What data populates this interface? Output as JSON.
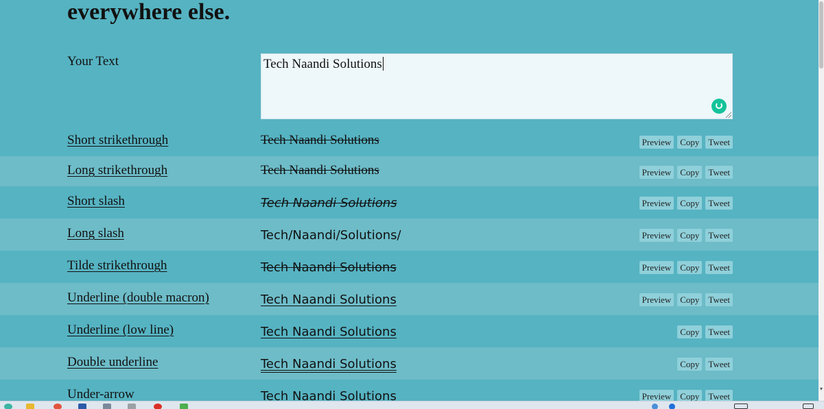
{
  "page": {
    "heading": "everywhere else."
  },
  "input": {
    "label": "Your Text",
    "value": "Tech Naandi Solutions"
  },
  "buttons": {
    "preview": "Preview",
    "copy": "Copy",
    "tweet": "Tweet"
  },
  "rows": [
    {
      "label": "Short strikethrough",
      "result": "Tech Naandi Solutions"
    },
    {
      "label": "Long strikethrough",
      "result": "Tech Naandi Solutions"
    },
    {
      "label": "Short slash",
      "result": "Tech Naandi Solutions"
    },
    {
      "label": "Long slash",
      "result": "Tech/Naandi/Solutions/"
    },
    {
      "label": "Tilde strikethrough",
      "result": "Tech Naandi Solutions"
    },
    {
      "label": "Underline (double macron)",
      "result": "Tech Naandi Solutions"
    },
    {
      "label": "Underline (low line)",
      "result": "Tech Naandi Solutions"
    },
    {
      "label": "Double underline",
      "result": "Tech Naandi Solutions"
    },
    {
      "label": "Under-arrow",
      "result": "Tech Naandi Solutions"
    }
  ],
  "icons": {
    "grammar": "grammarly-icon",
    "resize": "resize-handle-icon",
    "scroll_down": "chevron-down-icon"
  },
  "colors": {
    "background": "#56b3c2",
    "alt_row": "#6dbcc8",
    "button": "#8fd0da",
    "textarea": "#eef7fa"
  }
}
